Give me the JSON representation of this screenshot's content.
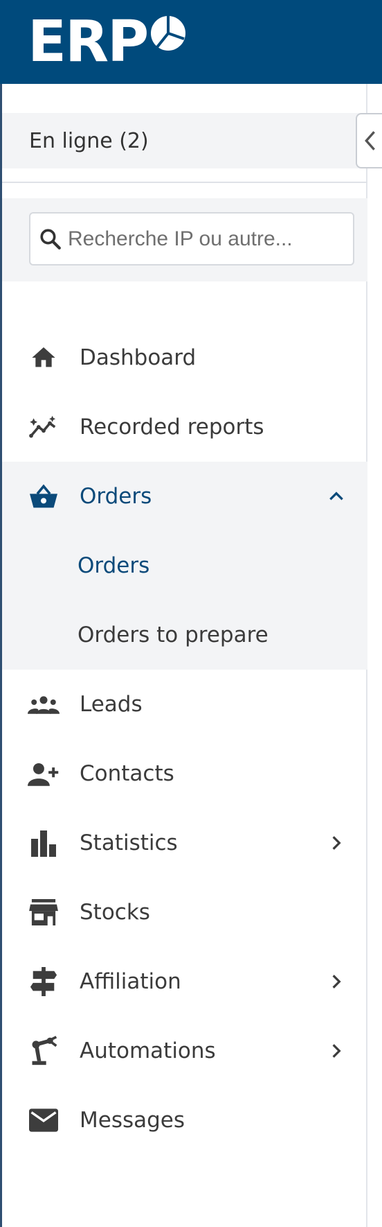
{
  "app": {
    "logo_text": "ERP"
  },
  "sidebar": {
    "online_label": "En ligne (2)",
    "search": {
      "placeholder": "Recherche IP ou autre..."
    },
    "items": [
      {
        "label": "Dashboard",
        "icon": "home-icon"
      },
      {
        "label": "Recorded reports",
        "icon": "sparkline-icon"
      },
      {
        "label": "Orders",
        "icon": "basket-icon",
        "expanded": true,
        "children": [
          {
            "label": "Orders",
            "active": true
          },
          {
            "label": "Orders to prepare"
          }
        ]
      },
      {
        "label": "Leads",
        "icon": "groups-icon"
      },
      {
        "label": "Contacts",
        "icon": "person-add-icon"
      },
      {
        "label": "Statistics",
        "icon": "bar-chart-icon",
        "has_submenu": true
      },
      {
        "label": "Stocks",
        "icon": "store-icon"
      },
      {
        "label": "Affiliation",
        "icon": "signpost-icon",
        "has_submenu": true
      },
      {
        "label": "Automations",
        "icon": "robot-arm-icon",
        "has_submenu": true
      },
      {
        "label": "Messages",
        "icon": "mail-icon"
      }
    ]
  },
  "colors": {
    "header": "#004a7c",
    "active": "#0b4a7a",
    "icon": "#3d3d3d",
    "group_bg": "#f3f4f6"
  }
}
